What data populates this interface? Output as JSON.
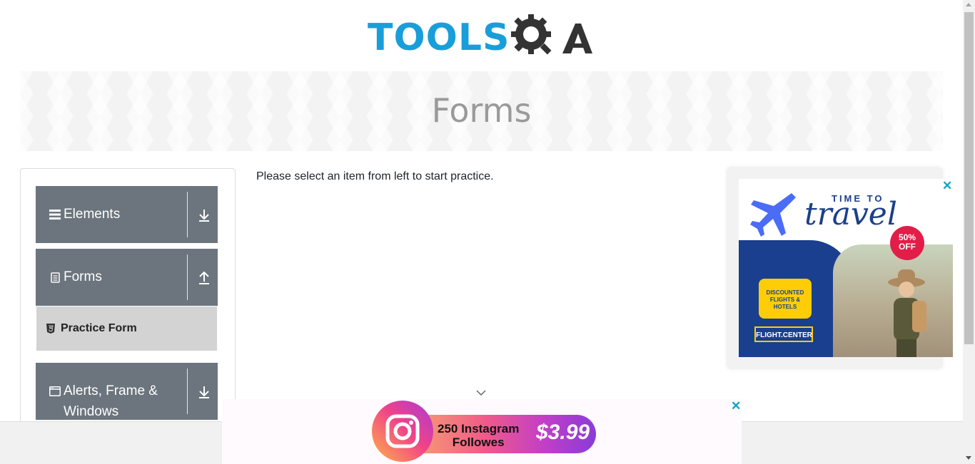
{
  "header": {
    "logo_text": "TOOLS",
    "logo_q": "QA",
    "logo_accent": "#1a9ed9"
  },
  "banner": {
    "title": "Forms"
  },
  "sidebar": {
    "groups": [
      {
        "label": "Elements",
        "icon": "hamburger-icon",
        "arrow": "download-arrow-icon"
      },
      {
        "label": "Forms",
        "icon": "document-icon",
        "arrow": "upload-arrow-icon"
      },
      {
        "label": "Alerts, Frame & Windows",
        "icon": "window-icon",
        "arrow": "download-arrow-icon"
      }
    ],
    "active_item": {
      "label": "Practice Form",
      "icon": "html5-shield-icon"
    },
    "group_color": "#6c757d",
    "active_bg": "#d3d3d3"
  },
  "main": {
    "message": "Please select an item from left to start practice."
  },
  "ad_right": {
    "time_to": "TIME TO",
    "travel": "travel",
    "badge": [
      "50%",
      "OFF"
    ],
    "bubble": [
      "DISCOUNTED",
      "FLIGHTS & HOTELS"
    ],
    "brand": "FLIGHT.CENTER",
    "close": "✕"
  },
  "ad_bottom": {
    "line1": "250 Instagram",
    "line2": "Followes",
    "price": "$3.99",
    "close": "✕"
  }
}
